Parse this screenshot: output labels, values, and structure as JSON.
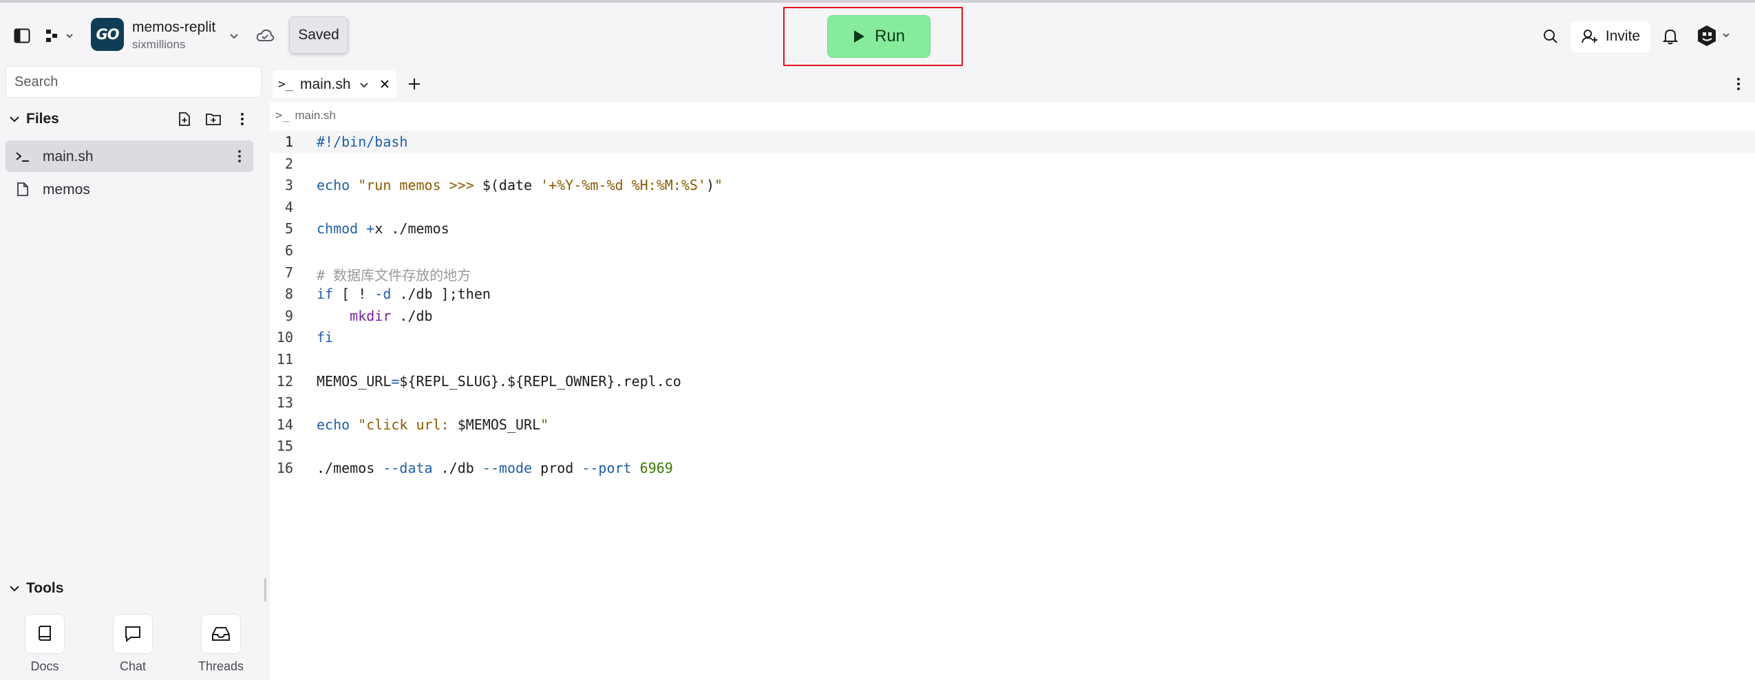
{
  "header": {
    "repl_logo_text": "GO",
    "repl_name": "memos-replit",
    "repl_owner": "sixmillions",
    "saved_tooltip": "Saved",
    "run_label": "Run",
    "invite_label": "Invite"
  },
  "sidebar": {
    "search_placeholder": "Search",
    "files_title": "Files",
    "files": [
      {
        "name": "main.sh",
        "icon": "shell-icon",
        "active": true
      },
      {
        "name": "memos",
        "icon": "file-icon",
        "active": false
      }
    ],
    "tools_title": "Tools",
    "tools": [
      {
        "label": "Docs",
        "icon": "book-icon"
      },
      {
        "label": "Chat",
        "icon": "chat-icon"
      },
      {
        "label": "Threads",
        "icon": "inbox-icon"
      }
    ]
  },
  "editor": {
    "tab_icon": ">_",
    "tab_label": "main.sh",
    "breadcrumb_icon": ">_",
    "breadcrumb": "main.sh",
    "lines": [
      [
        {
          "t": "#!/bin/bash",
          "c": "kw"
        }
      ],
      [],
      [
        {
          "t": "echo",
          "c": "kw"
        },
        {
          "t": " \"run memos >>> ",
          "c": "str"
        },
        {
          "t": "$(date ",
          "c": "plain"
        },
        {
          "t": "'+%Y-%m-%d %H:%M:%S'",
          "c": "str"
        },
        {
          "t": ")",
          "c": "plain"
        },
        {
          "t": "\"",
          "c": "str"
        }
      ],
      [],
      [
        {
          "t": "chmod",
          "c": "kw"
        },
        {
          "t": " +",
          "c": "op"
        },
        {
          "t": "x ./memos",
          "c": "plain"
        }
      ],
      [],
      [
        {
          "t": "# 数据库文件存放的地方",
          "c": "com"
        }
      ],
      [
        {
          "t": "if",
          "c": "kw"
        },
        {
          "t": " [ ! ",
          "c": "plain"
        },
        {
          "t": "-d",
          "c": "op"
        },
        {
          "t": " ./db ];then",
          "c": "plain"
        }
      ],
      [
        {
          "t": "    ",
          "c": "plain"
        },
        {
          "t": "mkdir",
          "c": "fn"
        },
        {
          "t": " ./db",
          "c": "plain"
        }
      ],
      [
        {
          "t": "fi",
          "c": "kw"
        }
      ],
      [],
      [
        {
          "t": "MEMOS_URL",
          "c": "plain"
        },
        {
          "t": "=",
          "c": "op"
        },
        {
          "t": "${REPL_SLUG}.${REPL_OWNER}.repl.co",
          "c": "plain"
        }
      ],
      [],
      [
        {
          "t": "echo",
          "c": "kw"
        },
        {
          "t": " \"click url: ",
          "c": "str"
        },
        {
          "t": "$MEMOS_URL",
          "c": "plain"
        },
        {
          "t": "\"",
          "c": "str"
        }
      ],
      [],
      [
        {
          "t": "./memos ",
          "c": "plain"
        },
        {
          "t": "--data",
          "c": "op"
        },
        {
          "t": " ./db ",
          "c": "plain"
        },
        {
          "t": "--mode",
          "c": "op"
        },
        {
          "t": " prod ",
          "c": "plain"
        },
        {
          "t": "--port",
          "c": "op"
        },
        {
          "t": " ",
          "c": "plain"
        },
        {
          "t": "6969",
          "c": "num"
        }
      ]
    ]
  },
  "colors": {
    "run_button": "#86ec9c",
    "highlight_box": "#e0141e",
    "repl_logo_bg": "#0f3d55"
  }
}
